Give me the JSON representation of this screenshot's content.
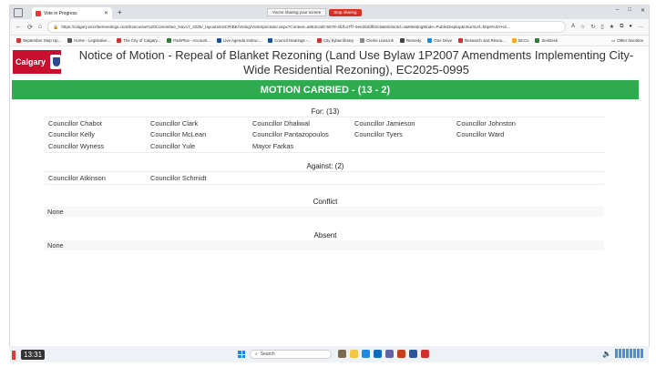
{
  "browser": {
    "tab_title": "Vote in Progress",
    "sharing_notice": "You're sharing your screen",
    "stop_sharing_label": "Stop sharing",
    "url": "https://calgary.escribemeetings.com/Executive%20Committee_Nov17_2025/_layouts/eSCRIBE/Voting/VoteSpectator.aspx?Context=a853c2d0-5978-4fdf-a7f7-0ee263df02c6&MotionId=4&MeetingMode=PublicDisplay&returnUrl=https%3A%2...",
    "favorites": [
      "September Step Up...",
      "Home - Legislative...",
      "The City of Calgary...",
      "ParkPlus - Account...",
      "Live Agenda Instruc...",
      "Council Hearings -...",
      "City bylaw library",
      "Clerks LiveLink",
      "Remedy",
      "One Drive",
      "Research and Resou...",
      "BCCs",
      "ZenDesk"
    ],
    "other_favorites": "Other favorites"
  },
  "logo_text": "Calgary",
  "title": "Notice of Motion - Repeal of Blanket Rezoning (Land Use Bylaw 1P2007 Amendments Implementing City-Wide Residential Rezoning), EC2025-0995",
  "banner": "MOTION CARRIED - (13 - 2)",
  "for_title": "For: (13)",
  "for_rows": [
    [
      "Councillor Chabot",
      "Councillor Clark",
      "Councillor Dhaliwal",
      "Councillor Jamieson",
      "Councillor Johnston"
    ],
    [
      "Councillor Kelly",
      "Councillor McLean",
      "Councillor Pantazopoulos",
      "Councillor Tyers",
      "Councillor Ward"
    ],
    [
      "Councillor Wyness",
      "Councillor Yule",
      "Mayor Farkas",
      "",
      ""
    ]
  ],
  "against_title": "Against: (2)",
  "against_rows": [
    [
      "Councillor Atkinson",
      "Councillor Schmidt",
      "",
      "",
      ""
    ]
  ],
  "conflict_title": "Conflict",
  "conflict_value": "None",
  "absent_title": "Absent",
  "absent_value": "None",
  "taskbar": {
    "time": "13:31",
    "search_placeholder": "Search"
  }
}
